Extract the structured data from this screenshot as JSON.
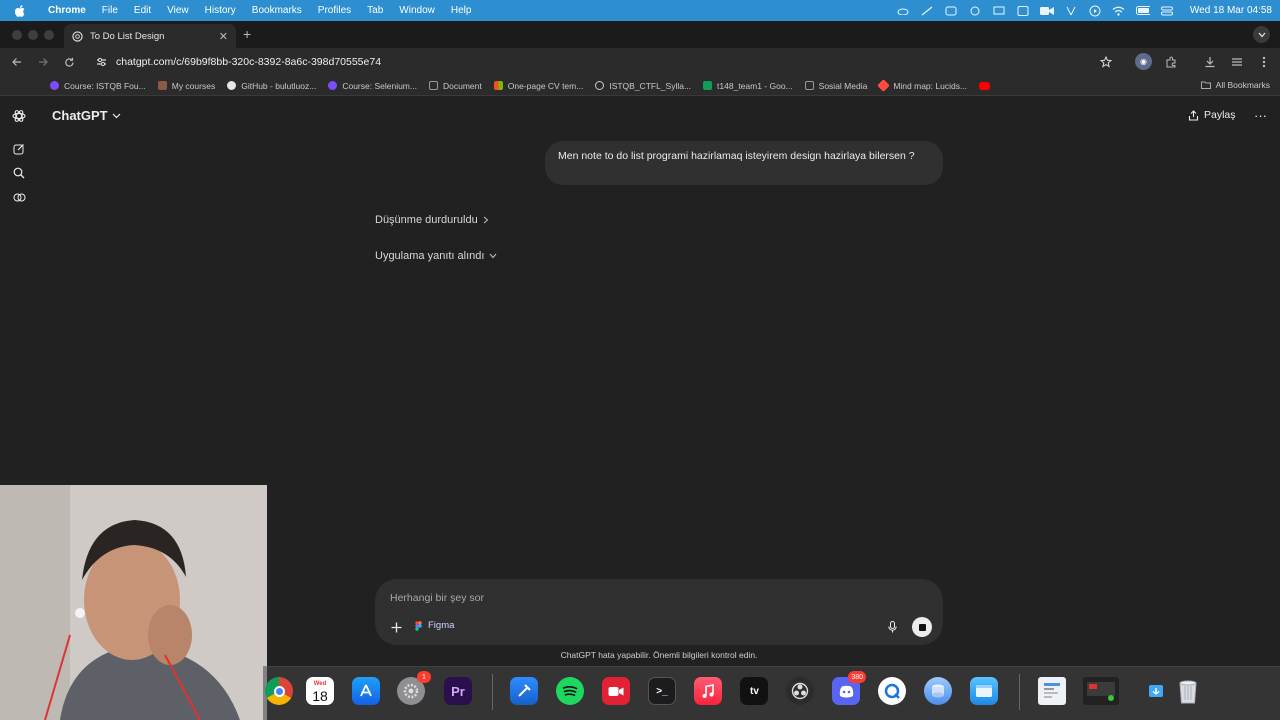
{
  "menubar": {
    "app_name": "Chrome",
    "items": [
      "File",
      "Edit",
      "View",
      "History",
      "Bookmarks",
      "Profiles",
      "Tab",
      "Window",
      "Help"
    ],
    "clock": "Wed 18 Mar  04:58"
  },
  "browser": {
    "tab_title": "To Do List Design",
    "url": "chatgpt.com/c/69b9f8bb-320c-8392-8a6c-398d70555e74",
    "bookmarks": [
      {
        "label": "Course: ISTQB Fou...",
        "color": "#7b4dff"
      },
      {
        "label": "My courses",
        "color": "#8a5a44"
      },
      {
        "label": "GitHub - bulutluoz...",
        "color": "#e6e6e6"
      },
      {
        "label": "Course: Selenium...",
        "color": "#7b4dff"
      },
      {
        "label": "Document",
        "color": "#888888"
      },
      {
        "label": "One-page CV tem...",
        "color": "#f4b400"
      },
      {
        "label": "ISTQB_CTFL_Sylla...",
        "color": "#cccccc"
      },
      {
        "label": "t148_team1 - Goo...",
        "color": "#0f9d58"
      },
      {
        "label": "Sosial Media",
        "color": "#888888"
      },
      {
        "label": "Mind map: Lucids...",
        "color": "#ff4a3d"
      }
    ],
    "all_bookmarks": "All Bookmarks"
  },
  "chat": {
    "model": "ChatGPT",
    "share_label": "Paylaş",
    "user_message": "Men note to do list programi hazirlamaq isteyirem design hazirlaya bilersen ?",
    "thinking_status": "Düşünme durduruldu",
    "app_status": "Uygulama yanıtı alındı",
    "composer_placeholder": "Herhangi bir şey sor",
    "figma_label": "Figma",
    "disclaimer": "ChatGPT hata yapabilir. Önemli bilgileri kontrol edin."
  },
  "dock": {
    "calendar_month": "Wed",
    "calendar_day": "18",
    "settings_badge": "1",
    "discord_badge": "380",
    "terminal_glyph": ">_",
    "premiere_label": "Pr",
    "tv_label": "tv"
  }
}
